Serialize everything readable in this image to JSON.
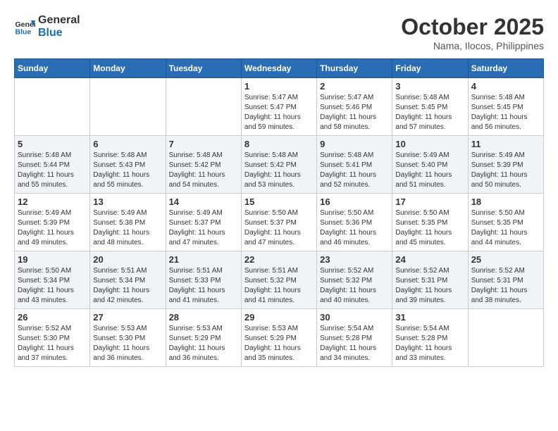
{
  "header": {
    "logo_line1": "General",
    "logo_line2": "Blue",
    "month": "October 2025",
    "location": "Nama, Ilocos, Philippines"
  },
  "days_of_week": [
    "Sunday",
    "Monday",
    "Tuesday",
    "Wednesday",
    "Thursday",
    "Friday",
    "Saturday"
  ],
  "weeks": [
    [
      {
        "day": "",
        "info": ""
      },
      {
        "day": "",
        "info": ""
      },
      {
        "day": "",
        "info": ""
      },
      {
        "day": "1",
        "info": "Sunrise: 5:47 AM\nSunset: 5:47 PM\nDaylight: 11 hours\nand 59 minutes."
      },
      {
        "day": "2",
        "info": "Sunrise: 5:47 AM\nSunset: 5:46 PM\nDaylight: 11 hours\nand 58 minutes."
      },
      {
        "day": "3",
        "info": "Sunrise: 5:48 AM\nSunset: 5:45 PM\nDaylight: 11 hours\nand 57 minutes."
      },
      {
        "day": "4",
        "info": "Sunrise: 5:48 AM\nSunset: 5:45 PM\nDaylight: 11 hours\nand 56 minutes."
      }
    ],
    [
      {
        "day": "5",
        "info": "Sunrise: 5:48 AM\nSunset: 5:44 PM\nDaylight: 11 hours\nand 55 minutes."
      },
      {
        "day": "6",
        "info": "Sunrise: 5:48 AM\nSunset: 5:43 PM\nDaylight: 11 hours\nand 55 minutes."
      },
      {
        "day": "7",
        "info": "Sunrise: 5:48 AM\nSunset: 5:42 PM\nDaylight: 11 hours\nand 54 minutes."
      },
      {
        "day": "8",
        "info": "Sunrise: 5:48 AM\nSunset: 5:42 PM\nDaylight: 11 hours\nand 53 minutes."
      },
      {
        "day": "9",
        "info": "Sunrise: 5:48 AM\nSunset: 5:41 PM\nDaylight: 11 hours\nand 52 minutes."
      },
      {
        "day": "10",
        "info": "Sunrise: 5:49 AM\nSunset: 5:40 PM\nDaylight: 11 hours\nand 51 minutes."
      },
      {
        "day": "11",
        "info": "Sunrise: 5:49 AM\nSunset: 5:39 PM\nDaylight: 11 hours\nand 50 minutes."
      }
    ],
    [
      {
        "day": "12",
        "info": "Sunrise: 5:49 AM\nSunset: 5:39 PM\nDaylight: 11 hours\nand 49 minutes."
      },
      {
        "day": "13",
        "info": "Sunrise: 5:49 AM\nSunset: 5:38 PM\nDaylight: 11 hours\nand 48 minutes."
      },
      {
        "day": "14",
        "info": "Sunrise: 5:49 AM\nSunset: 5:37 PM\nDaylight: 11 hours\nand 47 minutes."
      },
      {
        "day": "15",
        "info": "Sunrise: 5:50 AM\nSunset: 5:37 PM\nDaylight: 11 hours\nand 47 minutes."
      },
      {
        "day": "16",
        "info": "Sunrise: 5:50 AM\nSunset: 5:36 PM\nDaylight: 11 hours\nand 46 minutes."
      },
      {
        "day": "17",
        "info": "Sunrise: 5:50 AM\nSunset: 5:35 PM\nDaylight: 11 hours\nand 45 minutes."
      },
      {
        "day": "18",
        "info": "Sunrise: 5:50 AM\nSunset: 5:35 PM\nDaylight: 11 hours\nand 44 minutes."
      }
    ],
    [
      {
        "day": "19",
        "info": "Sunrise: 5:50 AM\nSunset: 5:34 PM\nDaylight: 11 hours\nand 43 minutes."
      },
      {
        "day": "20",
        "info": "Sunrise: 5:51 AM\nSunset: 5:34 PM\nDaylight: 11 hours\nand 42 minutes."
      },
      {
        "day": "21",
        "info": "Sunrise: 5:51 AM\nSunset: 5:33 PM\nDaylight: 11 hours\nand 41 minutes."
      },
      {
        "day": "22",
        "info": "Sunrise: 5:51 AM\nSunset: 5:32 PM\nDaylight: 11 hours\nand 41 minutes."
      },
      {
        "day": "23",
        "info": "Sunrise: 5:52 AM\nSunset: 5:32 PM\nDaylight: 11 hours\nand 40 minutes."
      },
      {
        "day": "24",
        "info": "Sunrise: 5:52 AM\nSunset: 5:31 PM\nDaylight: 11 hours\nand 39 minutes."
      },
      {
        "day": "25",
        "info": "Sunrise: 5:52 AM\nSunset: 5:31 PM\nDaylight: 11 hours\nand 38 minutes."
      }
    ],
    [
      {
        "day": "26",
        "info": "Sunrise: 5:52 AM\nSunset: 5:30 PM\nDaylight: 11 hours\nand 37 minutes."
      },
      {
        "day": "27",
        "info": "Sunrise: 5:53 AM\nSunset: 5:30 PM\nDaylight: 11 hours\nand 36 minutes."
      },
      {
        "day": "28",
        "info": "Sunrise: 5:53 AM\nSunset: 5:29 PM\nDaylight: 11 hours\nand 36 minutes."
      },
      {
        "day": "29",
        "info": "Sunrise: 5:53 AM\nSunset: 5:29 PM\nDaylight: 11 hours\nand 35 minutes."
      },
      {
        "day": "30",
        "info": "Sunrise: 5:54 AM\nSunset: 5:28 PM\nDaylight: 11 hours\nand 34 minutes."
      },
      {
        "day": "31",
        "info": "Sunrise: 5:54 AM\nSunset: 5:28 PM\nDaylight: 11 hours\nand 33 minutes."
      },
      {
        "day": "",
        "info": ""
      }
    ]
  ]
}
